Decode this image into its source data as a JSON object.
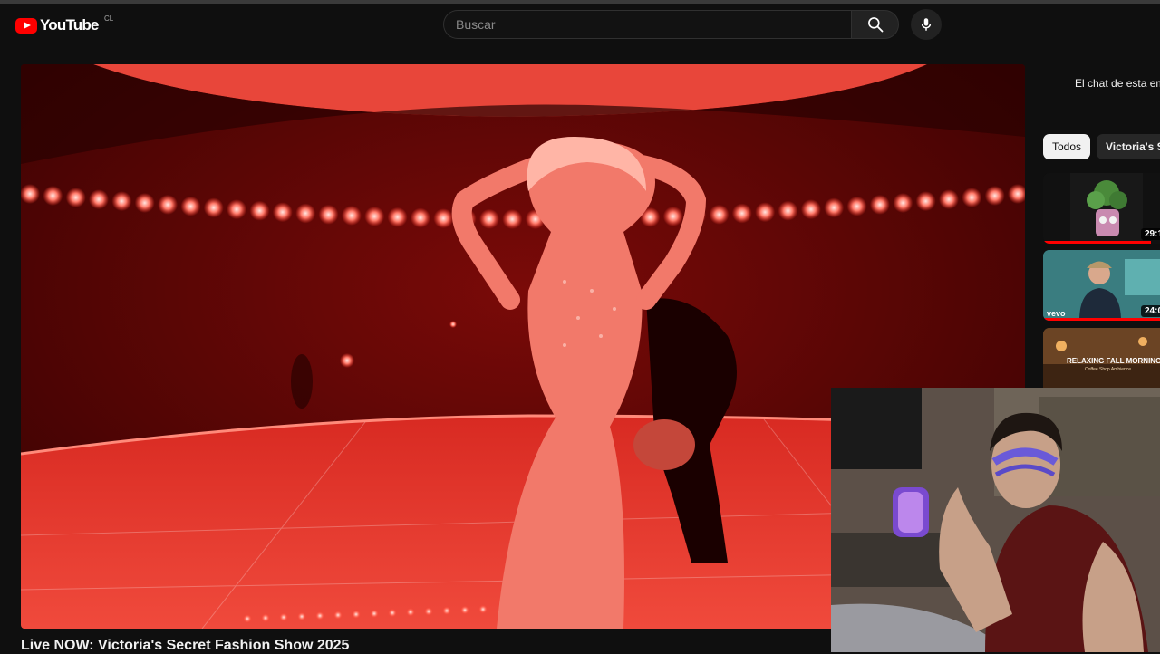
{
  "masthead": {
    "logo_text": "YouTube",
    "country_code": "CL",
    "search_placeholder": "Buscar"
  },
  "video": {
    "title": "Live NOW: Victoria's Secret Fashion Show 2025"
  },
  "secondary": {
    "chat_note": "El chat de esta em",
    "chips": [
      "Todos",
      "Victoria's Se"
    ],
    "recommendations": [
      {
        "duration": "29:1",
        "progress": 0.85,
        "thumbnail": "plant-illustration"
      },
      {
        "duration": "24:0",
        "badge": "vevo",
        "progress": 1.0,
        "thumbnail": "man-in-kitchen"
      },
      {
        "thumbnail_text": "RELAXING FALL MORNING",
        "thumbnail_subtext": "Coffee Shop Ambience"
      }
    ]
  },
  "colors": {
    "background": "#0f0f0f",
    "brand_red": "#ff0000",
    "video_tint": "#d01010"
  },
  "icons": [
    "youtube-logo-icon",
    "search-icon",
    "microphone-icon"
  ]
}
